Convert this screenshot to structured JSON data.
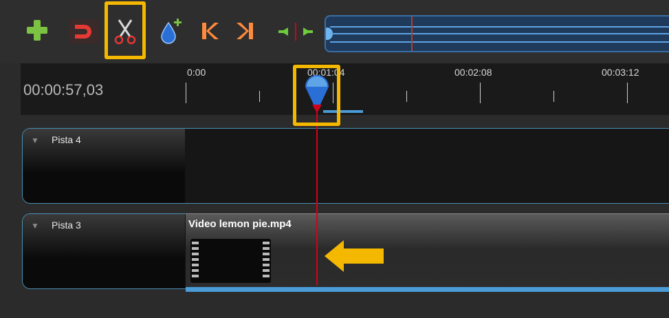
{
  "toolbar": {
    "buttons": [
      {
        "name": "add-track-button",
        "icon": "plus-icon",
        "color": "#7cc243"
      },
      {
        "name": "snapping-button",
        "icon": "magnet-icon",
        "color": "#e53935"
      },
      {
        "name": "razor-button",
        "icon": "scissors-icon",
        "color": "#ffffff",
        "highlighted": true
      },
      {
        "name": "add-marker-button",
        "icon": "marker-drop-icon",
        "color": "#2a6fd6"
      },
      {
        "name": "previous-marker-button",
        "icon": "jump-start-icon",
        "color": "#ff8a3d"
      },
      {
        "name": "next-marker-button",
        "icon": "jump-end-icon",
        "color": "#ff8a3d"
      },
      {
        "name": "center-playhead-button",
        "icon": "center-icon",
        "color": "#6ecb3c"
      }
    ]
  },
  "timeline": {
    "current_time": "00:00:57,03",
    "ticks": [
      "0:00",
      "00:01:04",
      "00:02:08",
      "00:03:12"
    ],
    "playhead_highlighted": true
  },
  "tracks": [
    {
      "name": "Pista 4",
      "clips": []
    },
    {
      "name": "Pista 3",
      "clips": [
        {
          "title": "Video lemon pie.mp4"
        }
      ]
    }
  ],
  "annotation": {
    "arrow_color": "#f5b800",
    "highlight_color": "#f5b800"
  }
}
